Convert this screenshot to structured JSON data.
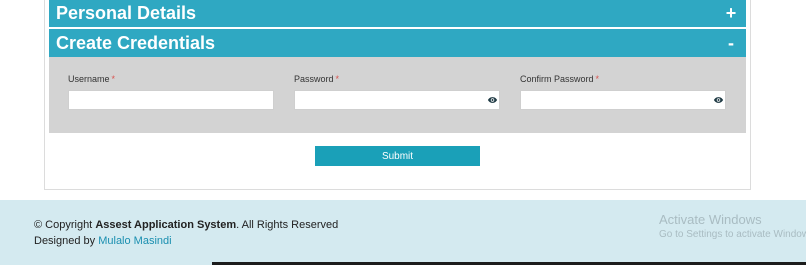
{
  "accordion": {
    "personal": {
      "title": "Personal Details",
      "toggle": "+"
    },
    "credentials": {
      "title": "Create Credentials",
      "toggle": "-"
    }
  },
  "form": {
    "username": {
      "label": "Username",
      "required_mark": "*",
      "value": ""
    },
    "password": {
      "label": "Password",
      "required_mark": "*",
      "value": ""
    },
    "confirm_password": {
      "label": "Confirm Password",
      "required_mark": "*",
      "value": ""
    },
    "submit_label": "Submit"
  },
  "footer": {
    "copyright_prefix": "© Copyright",
    "app_name": "Assest Application System",
    "copyright_suffix": ". All Rights Reserved",
    "designed_by_prefix": "Designed by",
    "designer_name": "Mulalo Masindi"
  },
  "watermark": {
    "title": "Activate Windows",
    "subtitle": "Go to Settings to activate Windows."
  },
  "icons": {
    "password_toggle": "eye-icon"
  },
  "colors": {
    "accordion_header": "#2fa8c2",
    "submit_button": "#1aa0b8",
    "footer_bg": "#d4eaf0",
    "link": "#1a8fb0",
    "required": "#d9534f"
  }
}
